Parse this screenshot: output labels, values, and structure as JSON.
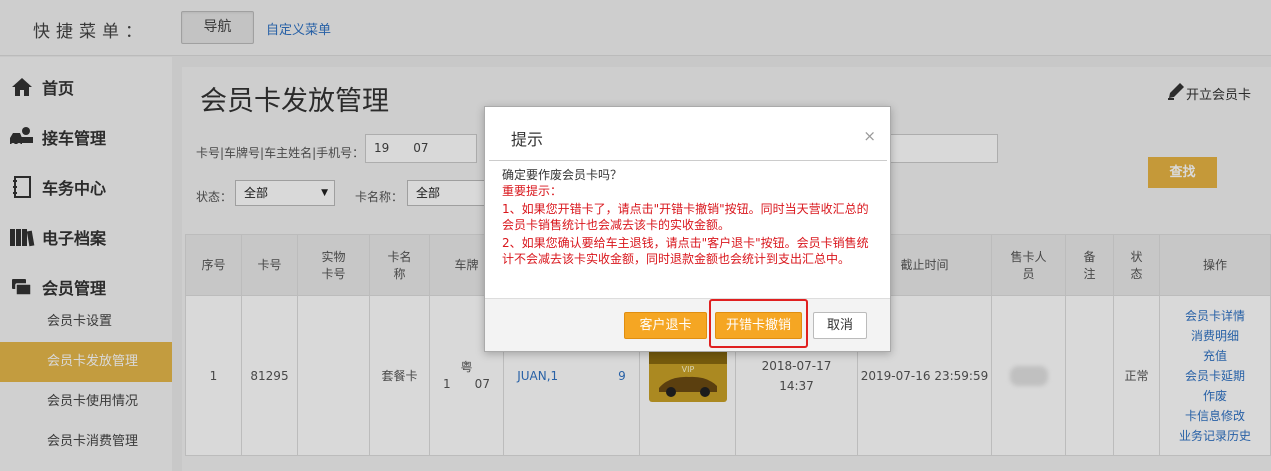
{
  "topbar": {
    "title": "快捷菜单：",
    "nav_button": "导航",
    "custom_menu_link": "自定义菜单"
  },
  "sidebar": {
    "items": [
      {
        "label": "首页",
        "icon": "home-icon"
      },
      {
        "label": "接车管理",
        "icon": "car-service-icon"
      },
      {
        "label": "车务中心",
        "icon": "book-icon"
      },
      {
        "label": "电子档案",
        "icon": "archive-icon"
      },
      {
        "label": "会员管理",
        "icon": "member-card-icon"
      }
    ],
    "sub_items": [
      {
        "label": "会员卡设置",
        "active": false
      },
      {
        "label": "会员卡发放管理",
        "active": true
      },
      {
        "label": "会员卡使用情况",
        "active": false
      },
      {
        "label": "会员卡消费管理",
        "active": false
      }
    ]
  },
  "main": {
    "title": "会员卡发放管理",
    "open_card_button": "开立会员卡",
    "filters": {
      "search_label": "卡号|车牌号|车主姓名|手机号：",
      "search_value": "19　　07",
      "status_label": "状态：",
      "status_value": "全部",
      "cardname_label": "卡名称：",
      "cardname_value": "全部",
      "search_button": "查找"
    },
    "table": {
      "headers": [
        "序号",
        "卡号",
        "实物卡号",
        "卡名称",
        "车牌",
        "",
        "",
        "",
        "截止时间",
        "售卡人员",
        "备注",
        "状态",
        "操作"
      ],
      "row": {
        "index": "1",
        "card_no": "81295",
        "physical_card_no": "",
        "card_name": "套餐卡",
        "plate_line1": "粤",
        "plate_line2": "1　　07",
        "owner": "JUAN,1　　　　　9",
        "issue_date": "2018-07-17",
        "issue_time": "14:37",
        "end_time": "2019-07-16 23:59:59",
        "status": "正常",
        "operations": [
          "会员卡详情",
          "消费明细",
          "充值",
          "会员卡延期",
          "作废",
          "卡信息修改",
          "业务记录历史"
        ]
      }
    }
  },
  "dialog": {
    "title": "提示",
    "close_icon": "×",
    "question": "确定要作废会员卡吗？",
    "notice_title": "重要提示：",
    "notice_1": "1、如果您开错卡了，请点击\"开错卡撤销\"按钮。同时当天营收汇总的会员卡销售统计也会减去该卡的实收金额。",
    "notice_2": "2、如果您确认要给车主退钱，请点击\"客户退卡\"按钮。会员卡销售统计不会减去该卡实收金额，同时退款金额也会统计到支出汇总中。",
    "buttons": {
      "customer_refund": "客户退卡",
      "undo_wrong_card": "开错卡撤销",
      "cancel": "取消"
    }
  },
  "colors": {
    "accent": "#e5b84a",
    "link": "#2f72c4",
    "warning_red": "#d9161c",
    "button_orange": "#f5a623"
  }
}
